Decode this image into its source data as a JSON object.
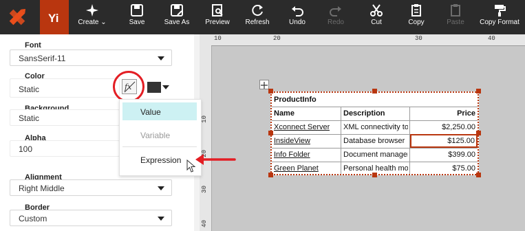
{
  "toolbar": {
    "buttons": [
      {
        "label": "Create",
        "icon": "sparkle-icon"
      },
      {
        "label": "Save",
        "icon": "save-icon"
      },
      {
        "label": "Save As",
        "icon": "save-as-icon"
      },
      {
        "label": "Preview",
        "icon": "preview-icon"
      },
      {
        "label": "Refresh",
        "icon": "refresh-icon"
      },
      {
        "label": "Undo",
        "icon": "undo-icon"
      },
      {
        "label": "Redo",
        "icon": "redo-icon"
      },
      {
        "label": "Cut",
        "icon": "scissors-icon"
      },
      {
        "label": "Copy",
        "icon": "copy-icon"
      },
      {
        "label": "Paste",
        "icon": "paste-icon"
      },
      {
        "label": "Copy Format",
        "icon": "paint-roller-icon"
      }
    ]
  },
  "panel": {
    "font": {
      "label": "Font",
      "value": "SansSerif-11"
    },
    "color": {
      "label": "Color",
      "value": "Static"
    },
    "background": {
      "label": "Background",
      "value": "Static"
    },
    "alpha": {
      "label": "Alpha",
      "value": "100"
    },
    "alignment": {
      "label": "Alignment",
      "value": "Right Middle"
    },
    "border": {
      "label": "Border",
      "value": "Custom"
    }
  },
  "menu": {
    "items": [
      "Value",
      "Variable",
      "Expression"
    ]
  },
  "ruler": {
    "ticks": [
      "10",
      "20",
      "30",
      "40"
    ],
    "vticks": [
      "10",
      "20",
      "30",
      "40"
    ]
  },
  "report": {
    "title": "ProductInfo",
    "columns": [
      "Name",
      "Description",
      "Price"
    ],
    "rows": [
      [
        "Xconnect Server",
        "XML connectivity to",
        "$2,250.00"
      ],
      [
        "InsideView",
        "Database browser",
        "$125.00"
      ],
      [
        "Info Folder",
        "Document manager",
        "$399.00"
      ],
      [
        "Green Planet",
        "Personal health mon",
        "$75.00"
      ]
    ]
  },
  "colors": {
    "toolbar_bg": "#2b2b2b",
    "accent": "#b9360f",
    "highlight_circle": "#e31e24",
    "menu_selected": "#cdf1f3",
    "canvas": "#c8c8c8"
  }
}
